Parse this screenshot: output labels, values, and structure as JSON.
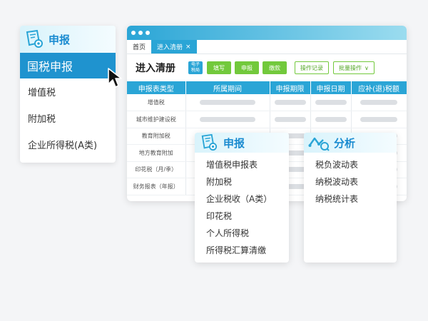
{
  "left_menu": {
    "title": "申报",
    "active_item": "国税申报",
    "items": [
      "增值税",
      "附加税",
      "企业所得税(A类)"
    ]
  },
  "window": {
    "tabs": {
      "home": "首页",
      "active": "进入清册",
      "close": "×"
    },
    "toolbar": {
      "page_title": "进入清册",
      "badge_line1": "电子",
      "badge_line2": "税局",
      "btn_fill": "填写",
      "btn_declare": "申报",
      "btn_pay": "缴款",
      "btn_log": "操作记录",
      "btn_batch": "批量操作",
      "batch_chevron": "∨"
    },
    "table": {
      "headers": [
        "申报表类型",
        "所属期间",
        "申报期限",
        "申报日期",
        "应补(退)税额"
      ],
      "rows": [
        "增值税",
        "城市维护建设税",
        "教育附加税",
        "地方教育附加",
        "印花税（月/季）",
        "财务报表（年报）"
      ]
    }
  },
  "declare_card": {
    "title": "申报",
    "items": [
      "增值税申报表",
      "附加税",
      "企业税收（A类）",
      "印花税",
      "个人所得税",
      "所得税汇算清缴"
    ]
  },
  "analysis_card": {
    "title": "分析",
    "items": [
      "税负波动表",
      "纳税波动表",
      "纳税统计表"
    ]
  },
  "colors": {
    "primary": "#2aa5d6",
    "accent_green": "#72c93c",
    "title_blue": "#1a8bd0"
  }
}
